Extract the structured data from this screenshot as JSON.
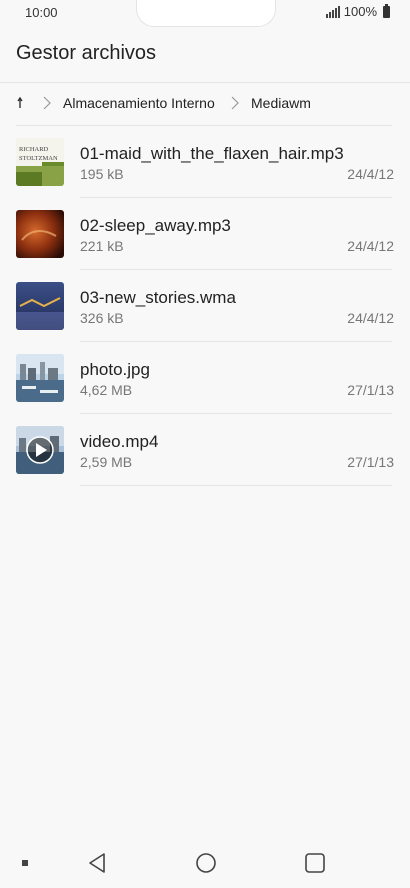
{
  "status": {
    "time": "10:00",
    "battery": "100%"
  },
  "app": {
    "title": "Gestor archivos"
  },
  "breadcrumb": {
    "items": [
      "Almacenamiento Interno",
      "Mediawm"
    ]
  },
  "files": [
    {
      "name": "01-maid_with_the_flaxen_hair.mp3",
      "size": "195 kB",
      "date": "24/4/12",
      "thumb": "richard-stoltzman-album-art",
      "thumb_text_1": "RICHARD",
      "thumb_text_2": "STOLTZMAN"
    },
    {
      "name": "02-sleep_away.mp3",
      "size": "221 kB",
      "date": "24/4/12",
      "thumb": "sleep-away-album-art"
    },
    {
      "name": "03-new_stories.wma",
      "size": "326 kB",
      "date": "24/4/12",
      "thumb": "new-stories-album-art"
    },
    {
      "name": "photo.jpg",
      "size": "4,62 MB",
      "date": "27/1/13",
      "thumb": "harbor-photo"
    },
    {
      "name": "video.mp4",
      "size": "2,59 MB",
      "date": "27/1/13",
      "thumb": "harbor-video-play"
    }
  ]
}
